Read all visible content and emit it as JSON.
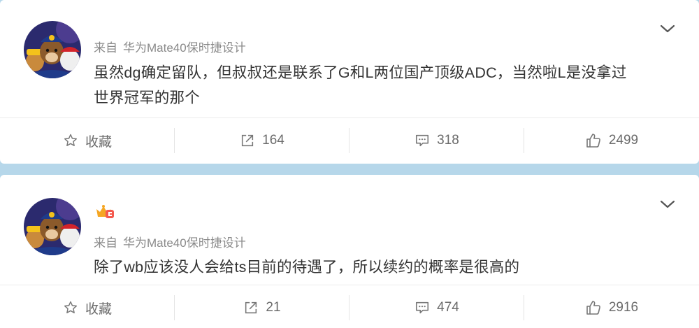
{
  "posts": [
    {
      "source_prefix": "来自",
      "source_device": "华为Mate40保时捷设计",
      "content_line1": "虽然dg确定留队，但叔叔还是联系了G和L两位国产顶级ADC，当然啦L是没拿过",
      "content_line2": "世界冠军的那个",
      "has_badge": false,
      "actions": {
        "favorite_label": "收藏",
        "repost_count": "164",
        "comment_count": "318",
        "like_count": "2499"
      }
    },
    {
      "source_prefix": "来自",
      "source_device": "华为Mate40保时捷设计",
      "content_line1": "除了wb应该没人会给ts目前的待遇了，所以续约的概率是很高的",
      "content_line2": "",
      "has_badge": true,
      "actions": {
        "favorite_label": "收藏",
        "repost_count": "21",
        "comment_count": "474",
        "like_count": "2916"
      }
    }
  ],
  "icons": {
    "expand": "chevron-down-icon",
    "favorite": "star-outline-icon",
    "repost": "share-arrow-icon",
    "comment": "comment-bubble-icon",
    "like": "thumbs-up-icon",
    "badge": "crown-badge-icon"
  },
  "colors": {
    "page_background": "#b6d7ea",
    "card_background": "#ffffff",
    "meta_text": "#8a8a8a",
    "body_text": "#333333",
    "action_text": "#6b6b6b",
    "badge_gold": "#f5a623",
    "badge_red": "#f4594d"
  }
}
